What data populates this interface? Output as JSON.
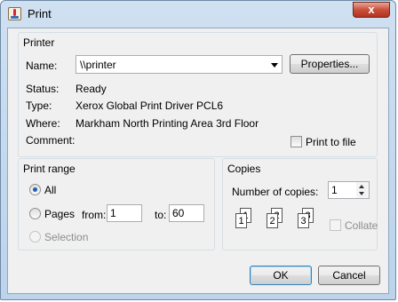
{
  "window": {
    "title": "Print",
    "close_glyph": "x"
  },
  "printer": {
    "group_title": "Printer",
    "name_label": "Name:",
    "name_value": "\\\\printer",
    "properties_label": "Properties...",
    "status_label": "Status:",
    "status_value": "Ready",
    "type_label": "Type:",
    "type_value": "Xerox Global Print Driver PCL6",
    "where_label": "Where:",
    "where_value": "Markham North Printing Area 3rd Floor",
    "comment_label": "Comment:",
    "print_to_file_label": "Print to file",
    "print_to_file_checked": false
  },
  "print_range": {
    "group_title": "Print range",
    "all_label": "All",
    "pages_label": "Pages",
    "from_label": "from:",
    "from_value": "1",
    "to_label": "to:",
    "to_value": "60",
    "selection_label": "Selection",
    "selected": "All"
  },
  "copies": {
    "group_title": "Copies",
    "number_label": "Number of copies:",
    "number_value": "1",
    "collate_label": "Collate",
    "collate_checked": false,
    "icon_pages": [
      "1",
      "1",
      "2",
      "2",
      "3",
      "3"
    ]
  },
  "buttons": {
    "ok_label": "OK",
    "cancel_label": "Cancel"
  }
}
